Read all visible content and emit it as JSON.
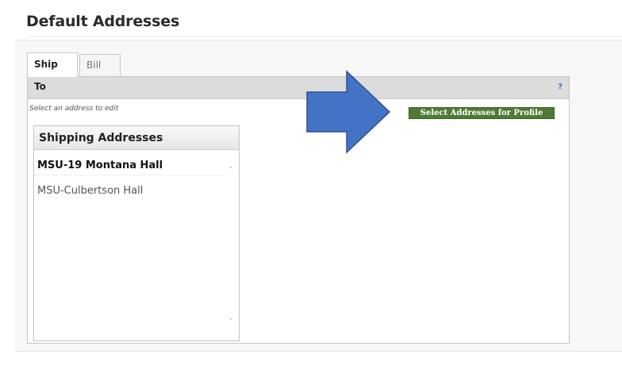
{
  "page": {
    "title": "Default Addresses"
  },
  "tabs": [
    {
      "label": "Ship To",
      "active": true
    },
    {
      "label": "Bill To",
      "active": false
    }
  ],
  "panel": {
    "help": "?",
    "hint": "Select an address to edit",
    "select_button": "Select Addresses for Profile"
  },
  "addresses": {
    "header": "Shipping Addresses",
    "items": [
      {
        "label": "MSU-19 Montana Hall",
        "selected": true
      },
      {
        "label": "MSU-Culbertson Hall",
        "selected": false
      }
    ]
  },
  "annotation": {
    "arrow_color": "#4472c4",
    "arrow_direction": "right"
  },
  "colors": {
    "button_green": "#4e7a34",
    "help_blue": "#3c78c8"
  }
}
